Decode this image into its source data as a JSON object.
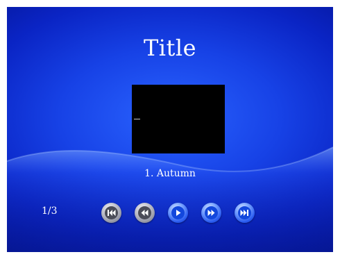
{
  "slide": {
    "title": "Title",
    "track_label": "1. Autumn",
    "counter": "1/3"
  },
  "controls": [
    {
      "name": "skip-to-start",
      "icon": "skip-back-icon",
      "style": "gray"
    },
    {
      "name": "rewind",
      "icon": "rewind-icon",
      "style": "gray"
    },
    {
      "name": "play",
      "icon": "play-icon",
      "style": "blue"
    },
    {
      "name": "fast-forward",
      "icon": "fast-forward-icon",
      "style": "blue"
    },
    {
      "name": "skip-to-end",
      "icon": "skip-forward-icon",
      "style": "blue"
    }
  ],
  "colors": {
    "background": "#1742e6",
    "text": "#ffffff",
    "video_area": "#000000"
  }
}
